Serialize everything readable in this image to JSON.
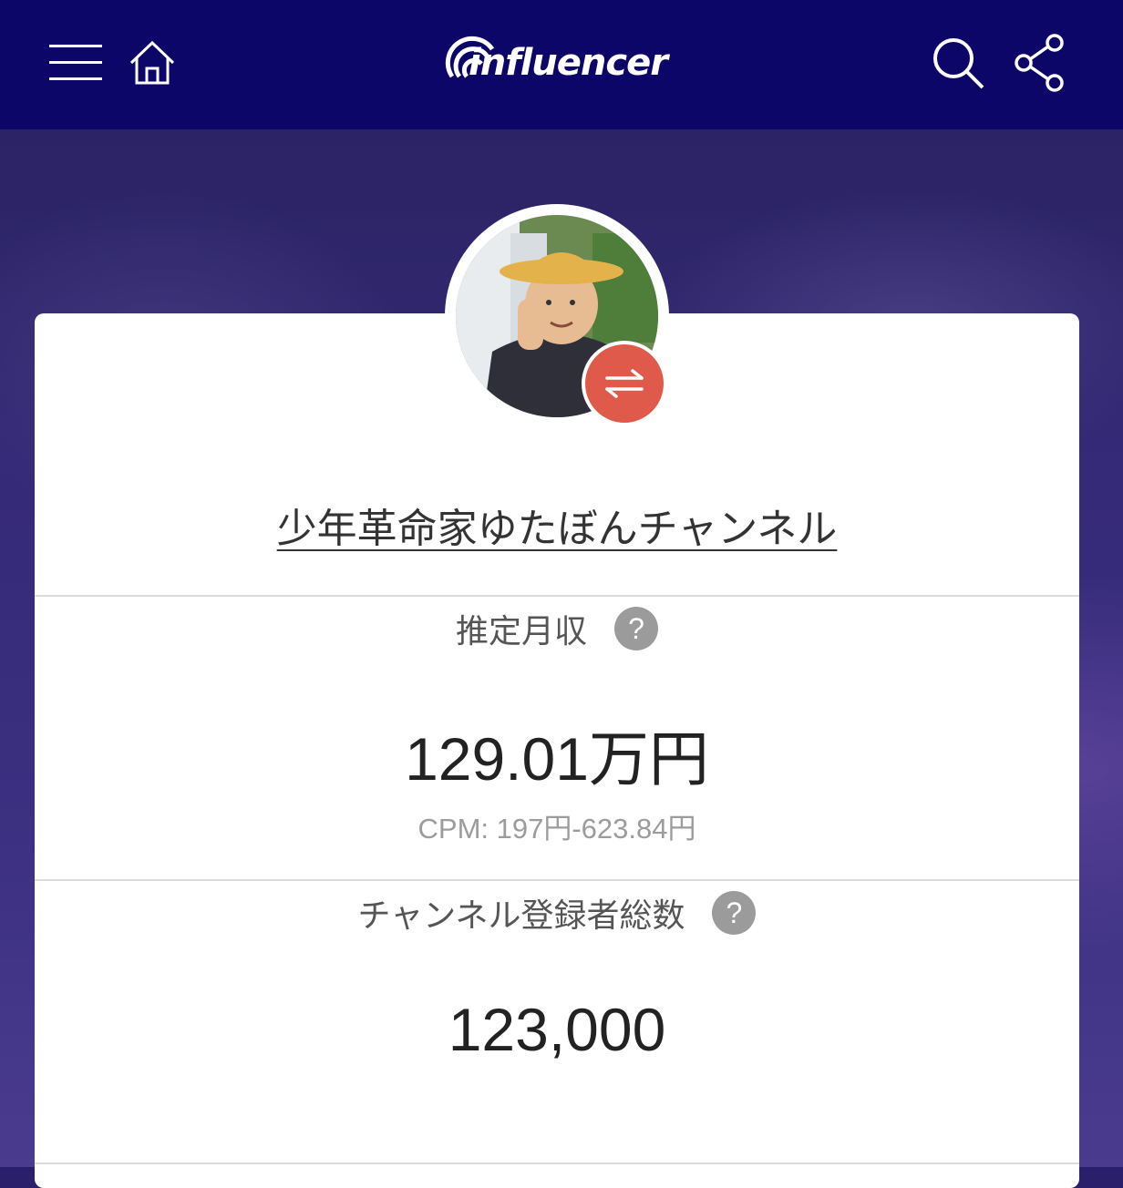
{
  "header": {
    "logo_text": "influencer",
    "menu_icon": "hamburger-menu-icon",
    "home_icon": "home-icon",
    "search_icon": "search-icon",
    "share_icon": "share-icon",
    "bg_color": "#0b0668"
  },
  "profile": {
    "channel_name": "少年革命家ゆたぼんチャンネル",
    "badge_icon": "swap-arrows-icon",
    "badge_color": "#e05a4b"
  },
  "stats": [
    {
      "label": "推定月収",
      "help": "?",
      "value": "129.01万円",
      "sub": "CPM: 197円-623.84円"
    },
    {
      "label": "チャンネル登録者総数",
      "help": "?",
      "value": "123,000"
    }
  ]
}
